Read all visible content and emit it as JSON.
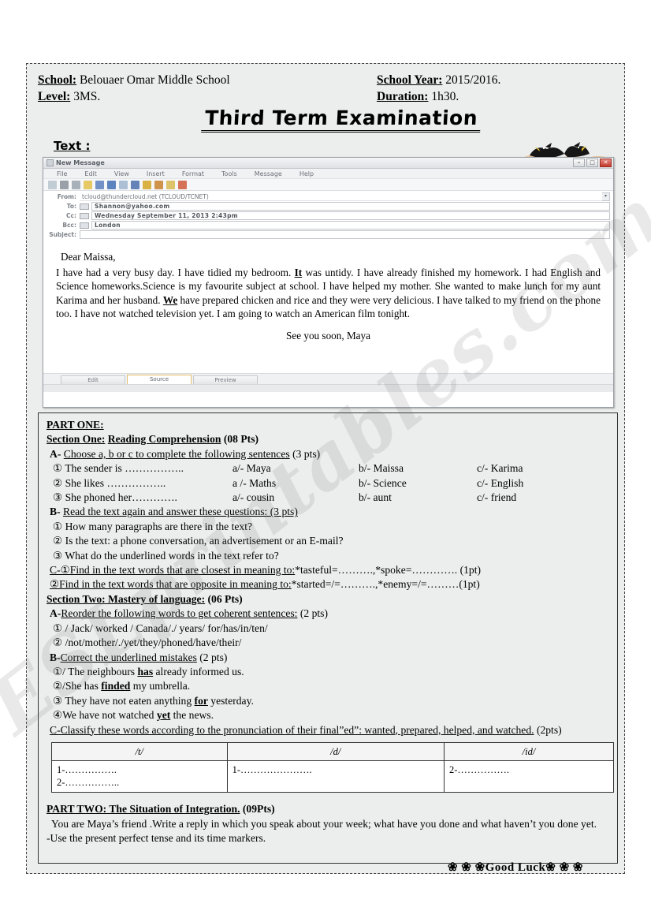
{
  "header": {
    "school_label": "School:",
    "school_value": "Belouaer Omar Middle School",
    "level_label": "Level:",
    "level_value": "3MS.",
    "school_year_label": "School Year:",
    "school_year_value": "2015/2016.",
    "duration_label": "Duration:",
    "duration_value": "1h30.",
    "title": "Third Term Examination",
    "text_label": "Text :"
  },
  "mail_window": {
    "title": "New Message",
    "minimize_label": "–",
    "maximize_label": "□",
    "close_label": "✕",
    "menus": [
      "File",
      "Edit",
      "View",
      "Insert",
      "Format",
      "Tools",
      "Message",
      "Help"
    ],
    "fields": [
      {
        "label": "From:",
        "value": "tcloud@thundercloud.net     (TCLOUD/TCNET)"
      },
      {
        "label": "To:",
        "value": "Shannon@yahoo.com"
      },
      {
        "label": "Cc:",
        "value": "Wednesday September 11, 2013  2:43pm"
      },
      {
        "label": "Bcc:",
        "value": "London"
      },
      {
        "label": "Subject:",
        "value": ""
      }
    ],
    "body": {
      "greeting": "Dear Maissa,",
      "para1_a": "I have had a very busy day. I have tidied my bedroom. ",
      "para1_b": "It",
      "para1_c": " was untidy. I have already finished my homework. I had English and Science homeworks.Science is my favourite subject at school. I have helped my mother. She wanted to make lunch for my aunt Karima and her husband. ",
      "para1_d": "We",
      "para1_e": " have prepared chicken and rice and they were very delicious. I have talked to my friend on the phone too. I have not watched television yet. I am going to watch an American film tonight.",
      "signature": "See you soon, Maya"
    },
    "tabs": [
      {
        "label": "Edit",
        "selected": false
      },
      {
        "label": "Source",
        "selected": true
      },
      {
        "label": "Preview",
        "selected": false
      }
    ]
  },
  "exam": {
    "part_one": "PART ONE:",
    "section_one_label": "Section One:",
    "section_one_title": "Reading Comprehension",
    "section_one_points": "(08 Pts)",
    "a_letter": "A-",
    "a_instruction": "Choose a, b or c to complete the following sentences",
    "a_points": "(3 pts)",
    "mcq": [
      {
        "num": "①",
        "question": "The sender is ……………..",
        "a": "a/- Maya",
        "b": "b/- Maissa",
        "c": "c/- Karima"
      },
      {
        "num": "②",
        "question": "She likes ……………..",
        "a": "a /- Maths",
        "b": "b/- Science",
        "c": "c/- English"
      },
      {
        "num": "③",
        "question": "She phoned her………….",
        "a": "a/- cousin",
        "b": "b/- aunt",
        "c": "c/- friend"
      }
    ],
    "b_letter": "B-",
    "b_instruction": "Read the text again and answer these questions: (3 pts)",
    "b_questions": [
      {
        "num": "①",
        "text": "How many paragraphs are there in the text?"
      },
      {
        "num": "②",
        "text": "Is the text: a phone conversation, an advertisement or an E-mail?"
      },
      {
        "num": "③",
        "text": "What do the underlined words in the text refer to?"
      }
    ],
    "c_line1_lead": "C-①Find in the text words that are closest in meaning to:",
    "c_line1_rest": "*tasteful=……….,*spoke=………….  (1pt)",
    "c_line2_lead": "②Find in the text words that are opposite in meaning to:",
    "c_line2_rest": "*started=/=……….,*enemy=/=………(1pt)",
    "section_two_label": "Section Two: Mastery of language:",
    "section_two_points": "(06 Pts)",
    "s2_a_letter": "A-",
    "s2_a_instruction": "Reorder the following words to get coherent sentences:",
    "s2_a_points": "(2 pts)",
    "reorder": [
      {
        "num": "①",
        "text": "/ Jack/ worked / Canada/./ years/ for/has/in/ten/"
      },
      {
        "num": "②",
        "text": "/not/mother/./yet/they/phoned/have/their/"
      }
    ],
    "s2_b_letter": "B-",
    "s2_b_instruction": "Correct the underlined mistakes",
    "s2_b_points": "(2 pts)",
    "corrections": [
      {
        "num": "①/",
        "pre": " The neighbours ",
        "word": "has",
        "post": " already informed us."
      },
      {
        "num": "②/",
        "pre": "She has ",
        "word": "finded",
        "post": " my umbrella."
      },
      {
        "num": "③",
        "pre": " They have not eaten anything ",
        "word": "for",
        "post": " yesterday."
      },
      {
        "num": "④",
        "pre": "We have not watched ",
        "word": "yet",
        "post": " the news."
      }
    ],
    "s2_c_text": "C-Classify these words according to the pronunciation of their final”ed”: wanted, prepared, helped, and watched.",
    "s2_c_points": "(2pts)",
    "phonetics_table": {
      "headers": [
        "/t/",
        "/d/",
        "/id/"
      ],
      "cells": [
        [
          "1-…………….",
          "2-…………….."
        ],
        [
          "1-…………………."
        ],
        [
          "2-……………."
        ]
      ]
    },
    "part_two_label": "PART TWO: The Situation of Integration.",
    "part_two_points": "(09Pts)",
    "part_two_body": "You are Maya’s friend .Write a reply in which you speak about your week; what have you done and what haven’t you done yet.",
    "part_two_hint": "-Use the present perfect tense and its time markers.",
    "good_luck": "❀ ❀ ❀Good Luck❀ ❀ ❀"
  },
  "watermark": {
    "text": "ESLprintables.com"
  }
}
